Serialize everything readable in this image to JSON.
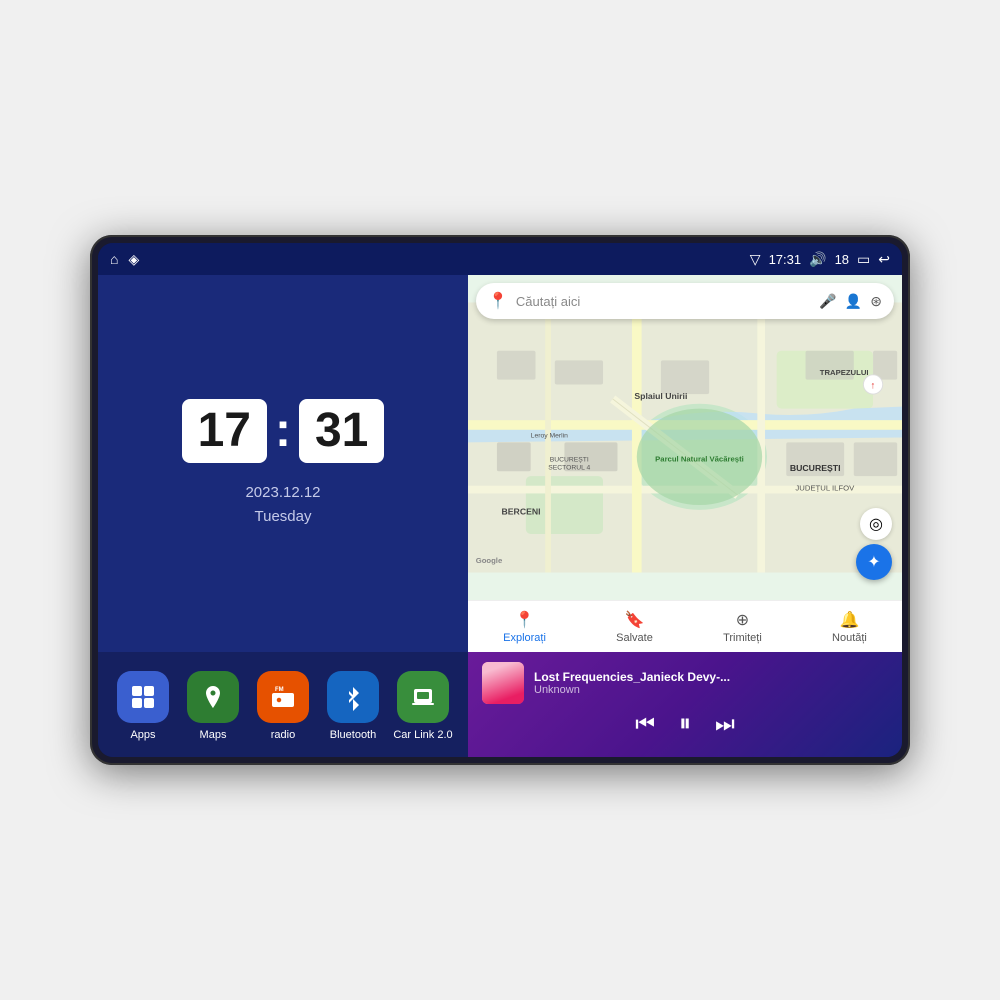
{
  "device": {
    "status_bar": {
      "left_icons": [
        "home",
        "location"
      ],
      "signal_icon": "▽",
      "time": "17:31",
      "volume_icon": "🔊",
      "volume_level": "18",
      "battery_icon": "▭",
      "back_icon": "↩"
    },
    "clock": {
      "hours": "17",
      "minutes": "31",
      "date": "2023.12.12",
      "day": "Tuesday"
    },
    "apps": [
      {
        "id": "apps",
        "label": "Apps",
        "icon": "⊞",
        "color": "#3a5fcf"
      },
      {
        "id": "maps",
        "label": "Maps",
        "icon": "📍",
        "color": "#2e7d32"
      },
      {
        "id": "radio",
        "label": "radio",
        "icon": "📻",
        "color": "#e65100"
      },
      {
        "id": "bluetooth",
        "label": "Bluetooth",
        "icon": "🔵",
        "color": "#1565c0"
      },
      {
        "id": "carlink",
        "label": "Car Link 2.0",
        "icon": "📱",
        "color": "#388e3c"
      }
    ],
    "map": {
      "search_placeholder": "Căutați aici",
      "bottom_nav": [
        {
          "id": "explore",
          "label": "Explorați",
          "icon": "📍",
          "active": true
        },
        {
          "id": "saved",
          "label": "Salvate",
          "icon": "🔖",
          "active": false
        },
        {
          "id": "send",
          "label": "Trimiteți",
          "icon": "⊕",
          "active": false
        },
        {
          "id": "news",
          "label": "Noutăți",
          "icon": "🔔",
          "active": false
        }
      ],
      "labels": {
        "berceni": "BERCENI",
        "bucuresti": "BUCUREȘTI",
        "judet": "JUDEȚUL ILFOV",
        "trapezului": "TRAPEZULUI",
        "sector4": "BUCUREȘTI SECTORUL 4",
        "park": "Parcul Natural Văcărești",
        "leroy": "Leroy Merlin"
      }
    },
    "music": {
      "title": "Lost Frequencies_Janieck Devy-...",
      "artist": "Unknown",
      "controls": {
        "prev": "⏮",
        "play": "⏸",
        "next": "⏭"
      }
    }
  }
}
